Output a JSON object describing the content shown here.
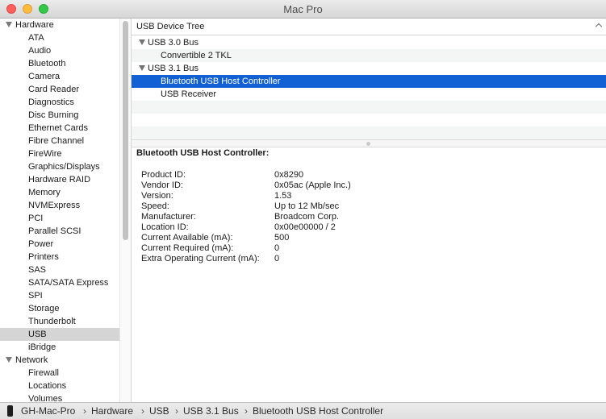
{
  "window": {
    "title": "Mac Pro"
  },
  "sidebar": {
    "groups": [
      {
        "label": "Hardware",
        "items": [
          "ATA",
          "Audio",
          "Bluetooth",
          "Camera",
          "Card Reader",
          "Diagnostics",
          "Disc Burning",
          "Ethernet Cards",
          "Fibre Channel",
          "FireWire",
          "Graphics/Displays",
          "Hardware RAID",
          "Memory",
          "NVMExpress",
          "PCI",
          "Parallel SCSI",
          "Power",
          "Printers",
          "SAS",
          "SATA/SATA Express",
          "SPI",
          "Storage",
          "Thunderbolt",
          "USB",
          "iBridge"
        ]
      },
      {
        "label": "Network",
        "items": [
          "Firewall",
          "Locations",
          "Volumes"
        ]
      }
    ],
    "selected": "USB"
  },
  "tree": {
    "header": "USB Device Tree",
    "rows": [
      {
        "label": "USB 3.0 Bus",
        "level": "bus",
        "expanded": true
      },
      {
        "label": "Convertible 2 TKL",
        "level": "device"
      },
      {
        "label": "USB 3.1 Bus",
        "level": "bus",
        "expanded": true
      },
      {
        "label": "Bluetooth USB Host Controller",
        "level": "device",
        "selected": true
      },
      {
        "label": "USB Receiver",
        "level": "device"
      }
    ]
  },
  "detail": {
    "title": "Bluetooth USB Host Controller:",
    "properties": [
      {
        "label": "Product ID:",
        "value": "0x8290"
      },
      {
        "label": "Vendor ID:",
        "value": "0x05ac (Apple Inc.)"
      },
      {
        "label": "Version:",
        "value": "1.53"
      },
      {
        "label": "Speed:",
        "value": "Up to 12 Mb/sec"
      },
      {
        "label": "Manufacturer:",
        "value": "Broadcom Corp."
      },
      {
        "label": "Location ID:",
        "value": "0x00e00000 / 2"
      },
      {
        "label": "Current Available (mA):",
        "value": "500"
      },
      {
        "label": "Current Required (mA):",
        "value": "0"
      },
      {
        "label": "Extra Operating Current (mA):",
        "value": "0"
      }
    ]
  },
  "statusbar": {
    "icon": "mac-pro-icon",
    "crumbs": [
      "GH-Mac-Pro",
      "Hardware",
      "USB",
      "USB 3.1 Bus",
      "Bluetooth USB Host Controller"
    ],
    "separator": "›"
  },
  "colors": {
    "selection": "#1160d4",
    "sidebar_selection": "#d5d5d5"
  }
}
